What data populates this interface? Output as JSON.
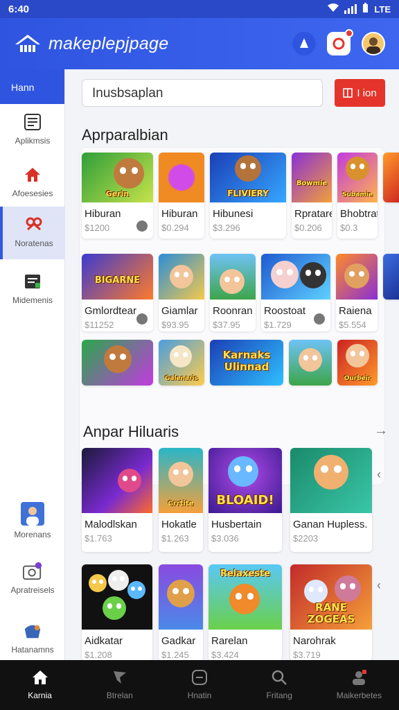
{
  "status": {
    "time": "6:40",
    "network": "LTE"
  },
  "app": {
    "title": "makeplepjpage"
  },
  "sidebar": {
    "header": "Hann",
    "items": [
      {
        "label": "Aplikmsis",
        "icon": "apps-icon"
      },
      {
        "label": "Afoesesies",
        "icon": "home-icon"
      },
      {
        "label": "Noratenas",
        "icon": "games-icon"
      },
      {
        "label": "Midemenis",
        "icon": "document-icon"
      },
      {
        "label": "Morenans",
        "icon": "person-icon"
      },
      {
        "label": "Apratreisels",
        "icon": "camera-icon"
      },
      {
        "label": "Hatanamns",
        "icon": "shop-icon"
      }
    ]
  },
  "search": {
    "value": "Inusbsaplan",
    "button_label": "I ion"
  },
  "sections": {
    "first_title": "Aprparalbian",
    "second_title": "Anpar Hiluaris"
  },
  "grid_rows": [
    [
      {
        "name": "Hiburan",
        "price": "$1200",
        "art": "Gerin"
      },
      {
        "name": "Hiburan",
        "price": "$0.294",
        "art": ""
      },
      {
        "name": "Hibunesi",
        "price": "$3.296",
        "art": "FLIVIERY"
      },
      {
        "name": "Rpratare",
        "price": "$0.206",
        "art": "Bowmie"
      },
      {
        "name": "Bhobtrat",
        "price": "$0.3",
        "art": "Subamie"
      }
    ],
    [
      {
        "name": "Gmlordtear",
        "price": "$11252",
        "art": "BIGARNE"
      },
      {
        "name": "Giamlar",
        "price": "$93.95",
        "art": ""
      },
      {
        "name": "Roonran",
        "price": "$37.95",
        "art": ""
      },
      {
        "name": "Roostoat",
        "price": "$1.729",
        "art": ""
      },
      {
        "name": "Raiena",
        "price": "$5.554",
        "art": ""
      }
    ],
    [
      {
        "name": "",
        "price": "",
        "art": ""
      },
      {
        "name": "",
        "price": "",
        "art": "Galenaris"
      },
      {
        "name": "",
        "price": "",
        "art": "Karnaks Ulinnad"
      },
      {
        "name": "",
        "price": "",
        "art": ""
      },
      {
        "name": "",
        "price": "",
        "art": "Ourbeir"
      }
    ]
  ],
  "rating": "★★★★★",
  "featured": [
    {
      "name": "Malodlskan",
      "price": "$1.763",
      "art": ""
    },
    {
      "name": "Hokatle",
      "price": "$1.263",
      "art": "Crrtite"
    },
    {
      "name": "Husbertain",
      "price": "$3.036",
      "art": "BLOAID!"
    },
    {
      "name": "Ganan Hupless.",
      "price": "$2203",
      "art": ""
    },
    {
      "name": "Aidkatar",
      "price": "$1.208",
      "art": ""
    },
    {
      "name": "Gadkar",
      "price": "$1.245",
      "art": ""
    },
    {
      "name": "Rarelan",
      "price": "$3.424",
      "art": "Relaxeste"
    },
    {
      "name": "Narohrak",
      "price": "$3.719",
      "art": "RANE ZOGEAS"
    }
  ],
  "bottom_nav": [
    {
      "label": "Karnia",
      "icon": "home-icon"
    },
    {
      "label": "Btrelan",
      "icon": "sword-icon"
    },
    {
      "label": "Hnatin",
      "icon": "tablet-icon"
    },
    {
      "label": "Fritang",
      "icon": "search-icon"
    },
    {
      "label": "Maikerbetes",
      "icon": "profile-icon"
    }
  ],
  "colors": {
    "primary": "#2f55e0",
    "accent_red": "#e5342b",
    "nav_bg": "#111111"
  }
}
